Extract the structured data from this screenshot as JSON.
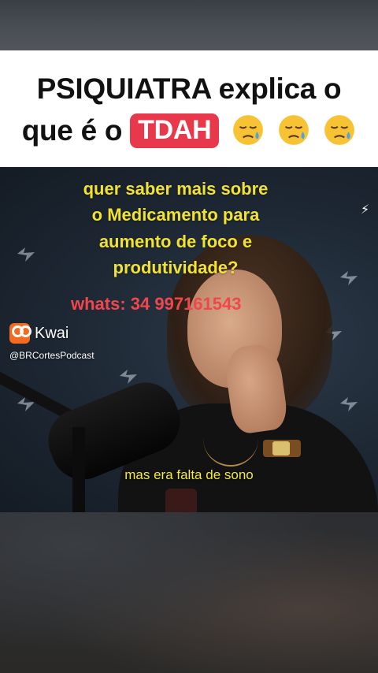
{
  "header": {
    "line1": "PSIQUIATRA explica o",
    "line2_prefix": "que é o",
    "badge": "TDAH",
    "emojis": [
      "sad-sweat-face-emoji",
      "sad-sweat-face-emoji",
      "sad-sweat-face-emoji"
    ],
    "badge_color": "#e8394c"
  },
  "video": {
    "promo_lines": [
      "quer saber mais sobre",
      "o Medicamento para",
      "aumento de foco e",
      "produtividade?"
    ],
    "whats": "whats: 34 997161543",
    "platform": "Kwai",
    "handle": "@BRCortesPodcast",
    "subtitle": "mas era falta de sono",
    "promo_color": "#f2e233",
    "whats_color": "#f1474c",
    "subtitle_color": "#f3ea3a"
  }
}
